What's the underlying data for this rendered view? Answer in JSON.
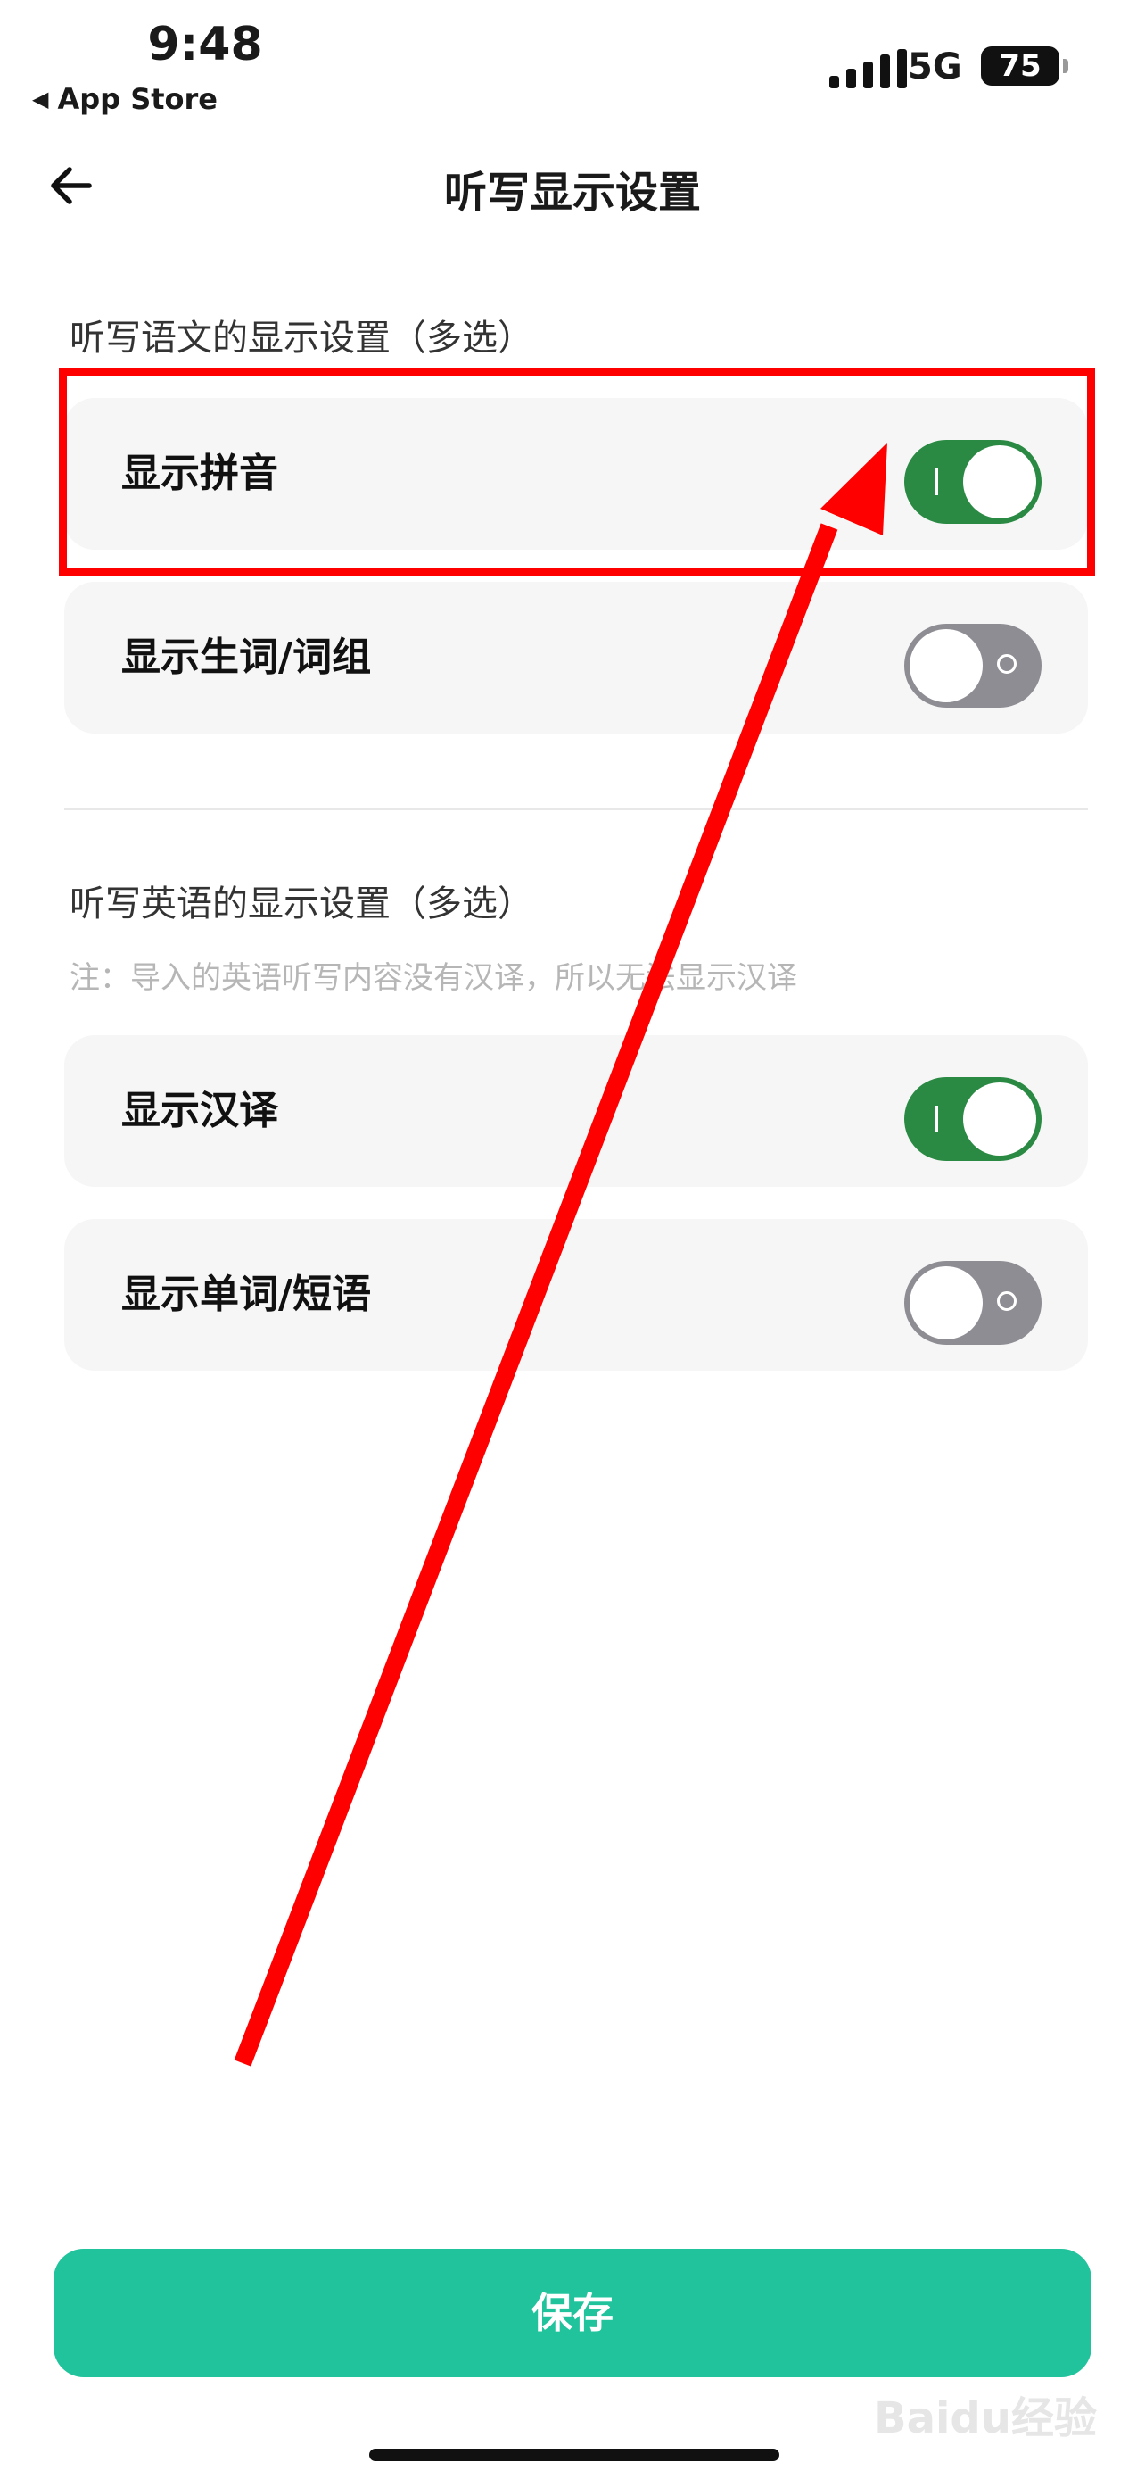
{
  "status_bar": {
    "time": "9:48",
    "back_app": "App Store",
    "network": "5G",
    "battery": "75"
  },
  "nav": {
    "title": "听写显示设置"
  },
  "chinese_section": {
    "title": "听写语文的显示设置（多选）",
    "items": [
      {
        "label": "显示拼音",
        "enabled": true
      },
      {
        "label": "显示生词/词组",
        "enabled": false
      }
    ]
  },
  "english_section": {
    "title": "听写英语的显示设置（多选）",
    "note": "注：导入的英语听写内容没有汉译，所以无法显示汉译",
    "items": [
      {
        "label": "显示汉译",
        "enabled": true
      },
      {
        "label": "显示单词/短语",
        "enabled": false
      }
    ]
  },
  "save_button": {
    "label": "保存"
  },
  "watermark": {
    "text": "Baidu经验"
  },
  "colors": {
    "toggle_on": "#2a8a44",
    "toggle_off": "#8d8d93",
    "save_button": "#20c39c",
    "annotation": "#ff0000"
  }
}
